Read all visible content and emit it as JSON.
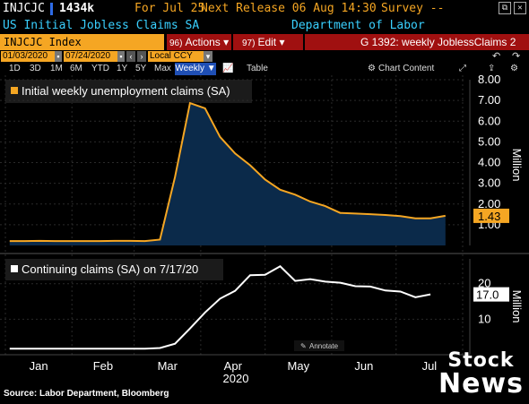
{
  "header": {
    "ticker": "INJCJC",
    "price": "1434k",
    "for_label": "For Jul 25",
    "next_release": "Next Release 06 Aug 14:30",
    "survey": "Survey --",
    "title": "US Initial Jobless Claims SA",
    "source_name": "Department of Labor"
  },
  "toolbar": {
    "index_label": "INJCJC Index",
    "actions_num": "96)",
    "actions_label": "Actions ▾",
    "edit_num": "97)",
    "edit_label": "Edit ▾",
    "chart_label": "G 1392: weekly JoblessClaims 2"
  },
  "dates": {
    "start": "01/03/2020",
    "end": "07/24/2020",
    "currency": "Local CCY"
  },
  "periods": [
    "1D",
    "3D",
    "1M",
    "6M",
    "YTD",
    "1Y",
    "5Y",
    "Max"
  ],
  "period_selected": "Weekly ▼",
  "table_label": "Table",
  "chart_content_label": "Chart Content",
  "colors": {
    "accent": "#f5a623",
    "panel_fill": "#0b2a4a",
    "toolbar_red": "#a01010",
    "title_cyan": "#39d0ff"
  },
  "chart_data": [
    {
      "type": "area",
      "legend": "Initial weekly unemployment claims (SA)",
      "unit": "Million",
      "ylim": [
        0,
        8
      ],
      "yticks": [
        "1.00",
        "2.00",
        "3.00",
        "4.00",
        "5.00",
        "6.00",
        "7.00",
        "8.00"
      ],
      "last_value": "1.43",
      "x": [
        "2020-01-03",
        "2020-01-10",
        "2020-01-17",
        "2020-01-24",
        "2020-01-31",
        "2020-02-07",
        "2020-02-14",
        "2020-02-21",
        "2020-02-28",
        "2020-03-06",
        "2020-03-13",
        "2020-03-20",
        "2020-03-27",
        "2020-04-03",
        "2020-04-10",
        "2020-04-17",
        "2020-04-24",
        "2020-05-01",
        "2020-05-08",
        "2020-05-15",
        "2020-05-22",
        "2020-05-29",
        "2020-06-05",
        "2020-06-12",
        "2020-06-19",
        "2020-06-26",
        "2020-07-03",
        "2020-07-10",
        "2020-07-17",
        "2020-07-24"
      ],
      "values": [
        0.21,
        0.21,
        0.22,
        0.21,
        0.21,
        0.21,
        0.21,
        0.22,
        0.22,
        0.21,
        0.28,
        3.31,
        6.87,
        6.62,
        5.24,
        4.44,
        3.87,
        3.18,
        2.69,
        2.45,
        2.12,
        1.9,
        1.57,
        1.54,
        1.51,
        1.47,
        1.42,
        1.31,
        1.31,
        1.43
      ]
    },
    {
      "type": "line",
      "legend": "Continuing claims (SA) on 7/17/20",
      "unit": "Million",
      "ylim": [
        0,
        27
      ],
      "yticks": [
        "10",
        "20"
      ],
      "last_value": "17.0",
      "x": [
        "2020-01-03",
        "2020-01-10",
        "2020-01-17",
        "2020-01-24",
        "2020-01-31",
        "2020-02-07",
        "2020-02-14",
        "2020-02-21",
        "2020-02-28",
        "2020-03-06",
        "2020-03-13",
        "2020-03-20",
        "2020-03-27",
        "2020-04-03",
        "2020-04-10",
        "2020-04-17",
        "2020-04-24",
        "2020-05-01",
        "2020-05-08",
        "2020-05-15",
        "2020-05-22",
        "2020-05-29",
        "2020-06-05",
        "2020-06-12",
        "2020-06-19",
        "2020-06-26",
        "2020-07-03",
        "2020-07-10",
        "2020-07-17"
      ],
      "values": [
        1.7,
        1.7,
        1.7,
        1.7,
        1.7,
        1.7,
        1.7,
        1.7,
        1.7,
        1.7,
        1.9,
        3.1,
        7.4,
        11.9,
        15.8,
        18.0,
        22.4,
        22.5,
        24.9,
        20.8,
        21.3,
        20.6,
        20.3,
        19.3,
        19.2,
        18.1,
        17.8,
        16.2,
        17.0
      ]
    }
  ],
  "x_axis": {
    "months": [
      "Jan",
      "Feb",
      "Mar",
      "Apr",
      "May",
      "Jun",
      "Jul"
    ],
    "year": "2020"
  },
  "annotate_label": "Annotate",
  "source_text": "Source: Labor Department, Bloomberg",
  "watermark": {
    "line1": "Stock",
    "line2": "News"
  }
}
